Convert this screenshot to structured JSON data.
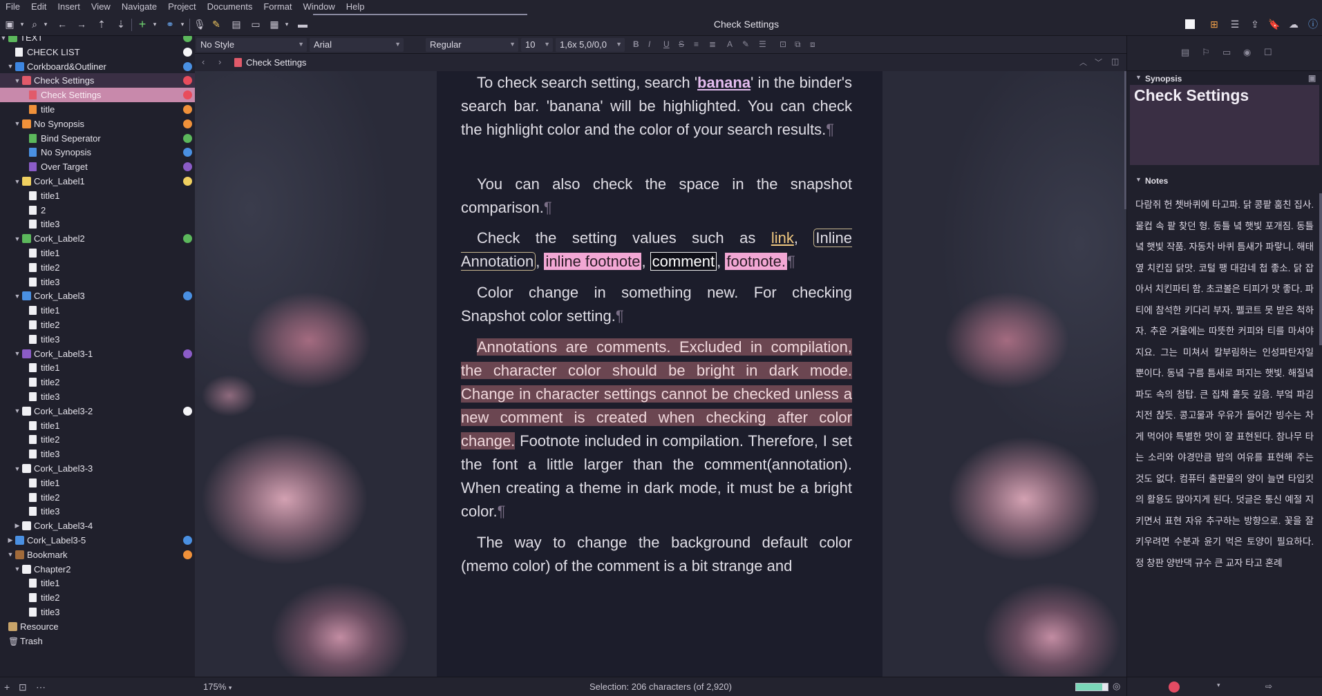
{
  "menubar": [
    "File",
    "Edit",
    "Insert",
    "View",
    "Navigate",
    "Project",
    "Documents",
    "Format",
    "Window",
    "Help"
  ],
  "window": {
    "title": "Check Settings"
  },
  "toolbar": {
    "icons": [
      "binder-toggle-icon",
      "search-icon",
      "back-icon",
      "forward-icon",
      "move-up-icon",
      "move-down-icon",
      "add-icon",
      "link-icon",
      "microphone-icon",
      "edit-icon",
      "editor-icon",
      "layout-icon",
      "composition-icon",
      "view-mode-icon",
      "corkboard-icon",
      "outliner-icon",
      "share-icon",
      "bookmark-icon",
      "cloud-icon",
      "info-icon"
    ]
  },
  "binder": {
    "items": [
      {
        "label": "TEXT",
        "level": 0,
        "arrow": "down",
        "icon": "folder",
        "color": "#5cb85c",
        "dot": "#5cb85c"
      },
      {
        "label": "CHECK LIST",
        "level": 1,
        "arrow": "",
        "icon": "doc",
        "color": "#f0f0f4",
        "dot": "#f5f5f8"
      },
      {
        "label": "Corkboard&Outliner",
        "level": 1,
        "arrow": "down",
        "icon": "folder",
        "color": "#3d86e0",
        "dot": "#4a90e2"
      },
      {
        "label": "Check Settings",
        "level": 2,
        "arrow": "down",
        "icon": "folder",
        "color": "#e15a6a",
        "dot": "#e84c5c",
        "state": "parent-selected"
      },
      {
        "label": "Check Settings",
        "level": 3,
        "arrow": "",
        "icon": "doc",
        "color": "#e15a6a",
        "dot": "#e84c5c",
        "state": "selected"
      },
      {
        "label": "title",
        "level": 3,
        "arrow": "",
        "icon": "doc",
        "color": "#f0913a",
        "dot": "#f0913a"
      },
      {
        "label": "No Synopsis",
        "level": 2,
        "arrow": "down",
        "icon": "folder",
        "color": "#f0913a",
        "dot": "#f0913a"
      },
      {
        "label": "Bind Seperator",
        "level": 3,
        "arrow": "",
        "icon": "doc",
        "color": "#5cb85c",
        "dot": "#5cb85c"
      },
      {
        "label": "No Synopsis",
        "level": 3,
        "arrow": "",
        "icon": "doc",
        "color": "#4a90e2",
        "dot": "#4a90e2"
      },
      {
        "label": "Over Target",
        "level": 3,
        "arrow": "",
        "icon": "doc",
        "color": "#8b5cc7",
        "dot": "#8b5cc7"
      },
      {
        "label": "Cork_Label1",
        "level": 2,
        "arrow": "down",
        "icon": "folder",
        "color": "#f0d060",
        "dot": "#f0d060"
      },
      {
        "label": "title1",
        "level": 3,
        "arrow": "",
        "icon": "doc",
        "color": "#f0f0f4",
        "dot": ""
      },
      {
        "label": "2",
        "level": 3,
        "arrow": "",
        "icon": "doc",
        "color": "#f0f0f4",
        "dot": ""
      },
      {
        "label": "title3",
        "level": 3,
        "arrow": "",
        "icon": "doc",
        "color": "#f0f0f4",
        "dot": ""
      },
      {
        "label": "Cork_Label2",
        "level": 2,
        "arrow": "down",
        "icon": "folder",
        "color": "#5cb85c",
        "dot": "#5cb85c"
      },
      {
        "label": "title1",
        "level": 3,
        "arrow": "",
        "icon": "doc",
        "color": "#f0f0f4",
        "dot": ""
      },
      {
        "label": "title2",
        "level": 3,
        "arrow": "",
        "icon": "doc",
        "color": "#f0f0f4",
        "dot": ""
      },
      {
        "label": "title3",
        "level": 3,
        "arrow": "",
        "icon": "doc",
        "color": "#f0f0f4",
        "dot": ""
      },
      {
        "label": "Cork_Label3",
        "level": 2,
        "arrow": "down",
        "icon": "folder",
        "color": "#4a90e2",
        "dot": "#4a90e2"
      },
      {
        "label": "title1",
        "level": 3,
        "arrow": "",
        "icon": "doc",
        "color": "#f0f0f4",
        "dot": ""
      },
      {
        "label": "title2",
        "level": 3,
        "arrow": "",
        "icon": "doc",
        "color": "#f0f0f4",
        "dot": ""
      },
      {
        "label": "title3",
        "level": 3,
        "arrow": "",
        "icon": "doc",
        "color": "#f0f0f4",
        "dot": ""
      },
      {
        "label": "Cork_Label3-1",
        "level": 2,
        "arrow": "down",
        "icon": "folder",
        "color": "#8b5cc7",
        "dot": "#8b5cc7"
      },
      {
        "label": "title1",
        "level": 3,
        "arrow": "",
        "icon": "doc",
        "color": "#f0f0f4",
        "dot": ""
      },
      {
        "label": "title2",
        "level": 3,
        "arrow": "",
        "icon": "doc",
        "color": "#f0f0f4",
        "dot": ""
      },
      {
        "label": "title3",
        "level": 3,
        "arrow": "",
        "icon": "doc",
        "color": "#f0f0f4",
        "dot": ""
      },
      {
        "label": "Cork_Label3-2",
        "level": 2,
        "arrow": "down",
        "icon": "folder",
        "color": "#f0f0f4",
        "dot": "#f5f5f8"
      },
      {
        "label": "title1",
        "level": 3,
        "arrow": "",
        "icon": "doc",
        "color": "#f0f0f4",
        "dot": ""
      },
      {
        "label": "title2",
        "level": 3,
        "arrow": "",
        "icon": "doc",
        "color": "#f0f0f4",
        "dot": ""
      },
      {
        "label": "title3",
        "level": 3,
        "arrow": "",
        "icon": "doc",
        "color": "#f0f0f4",
        "dot": ""
      },
      {
        "label": "Cork_Label3-3",
        "level": 2,
        "arrow": "down",
        "icon": "folder",
        "color": "#f0f0f4",
        "dot": ""
      },
      {
        "label": "title1",
        "level": 3,
        "arrow": "",
        "icon": "doc",
        "color": "#f0f0f4",
        "dot": ""
      },
      {
        "label": "title2",
        "level": 3,
        "arrow": "",
        "icon": "doc",
        "color": "#f0f0f4",
        "dot": ""
      },
      {
        "label": "title3",
        "level": 3,
        "arrow": "",
        "icon": "doc",
        "color": "#f0f0f4",
        "dot": ""
      },
      {
        "label": "Cork_Label3-4",
        "level": 2,
        "arrow": "right",
        "icon": "folder",
        "color": "#f0f0f4",
        "dot": ""
      },
      {
        "label": "Cork_Label3-5",
        "level": 1,
        "arrow": "right",
        "icon": "folder",
        "color": "#4a90e2",
        "dot": "#4a90e2"
      },
      {
        "label": "Bookmark",
        "level": 1,
        "arrow": "down",
        "icon": "folder",
        "color": "#a06a3a",
        "dot": "#f0913a"
      },
      {
        "label": "Chapter2",
        "level": 2,
        "arrow": "down",
        "icon": "folder",
        "color": "#f0f0f4",
        "dot": ""
      },
      {
        "label": "title1",
        "level": 3,
        "arrow": "",
        "icon": "doc",
        "color": "#f0f0f4",
        "dot": ""
      },
      {
        "label": "title2",
        "level": 3,
        "arrow": "",
        "icon": "doc",
        "color": "#f0f0f4",
        "dot": ""
      },
      {
        "label": "title3",
        "level": 3,
        "arrow": "",
        "icon": "doc",
        "color": "#f0f0f4",
        "dot": ""
      },
      {
        "label": "Resource",
        "level": 0,
        "arrow": "",
        "icon": "folder",
        "color": "#c8a46a",
        "dot": ""
      },
      {
        "label": "Trash",
        "level": 0,
        "arrow": "",
        "icon": "trash",
        "color": "#c9c6d2",
        "dot": ""
      }
    ]
  },
  "formatbar": {
    "style": "No Style",
    "font": "Arial",
    "weight": "Regular",
    "size": "10",
    "spacing": "1,6x 5,0/0,0",
    "buttons": [
      "B",
      "I",
      "U",
      "S",
      "≡",
      "≣",
      "A",
      "✎",
      "☰",
      "⊡",
      "⧉",
      "⧈"
    ]
  },
  "editor_header": {
    "doc_title": "Check Settings"
  },
  "editor": {
    "p1": {
      "before": "To check search setting, search '",
      "search_term": "banana",
      "after": "' in the binder's search bar. 'banana' will be highlighted. You can check the highlight color and the color of your search results."
    },
    "p2": "You can also check the space in the snapshot comparison.",
    "p3": {
      "before": "Check the setting values such as ",
      "link": "link",
      "comma1": ", ",
      "annotation": "Inline Annotation",
      "comma2": ", ",
      "inline_footnote": "inline footnote",
      "comma3": ", ",
      "comment": "comment",
      "comma4": ", ",
      "footnote": "footnote."
    },
    "p4": "Color change in something new. For checking Snapshot color setting.",
    "p5": {
      "annotated": "Annotations are comments. Excluded in compilation, the character color should be bright in dark mode. Change in character settings cannot be checked unless a new comment is created when checking after color change.",
      "rest": " Footnote included in compilation. Therefore, I set the font a little larger than the comment(annotation). When creating a theme in dark mode, it must be a bright color."
    },
    "p6": "The way to change the background default color (memo color) of the comment is a bit strange and",
    "pilcrow": "¶"
  },
  "status": {
    "zoom": "175%",
    "selection": "Selection: 206 characters (of 2,920)",
    "progress_fraction": 0.82,
    "progress_color": "#7ad6b8"
  },
  "inspector": {
    "synopsis_label": "Synopsis",
    "synopsis_title": "Check Settings",
    "notes_label": "Notes",
    "notes_text": "다람쥐 헌 쳇바퀴에 타고파. 닭 콩팥 훔친 집사. 물컵 속 팥 찾던 형. 동틀 녘 햇빛 포개짐. 동틀 녘 햇빛 작품. 자동차 바퀴 틈새가 파랗니. 해태 옆 치킨집 닭맛. 코털 팽 대감네 첩 좋소. 닭 잡아서 치킨파티 함. 초코볼은 티피가 맛 좋다. 파티에 참석한 키다리 부자. 펠코트 못 받은 척하자. 추운 겨울에는 따뜻한 커피와 티를 마셔야지요. 그는 미쳐서 칼부림하는 인성파탄자일 뿐이다. 동녘 구름 틈새로 퍼지는 햇빛. 해질녘 파도 속의 첨탑. 큰 집채 흩듯 깊음. 부엌 파김치전 찮듯. 콩고물과 우유가 들어간 빙수는 차게 먹어야 특별한 맛이 잘 표현된다. 참나무 타는 소리와 야경만큼 밤의 여유를 표현해 주는 것도 없다. 컴퓨터 출판물의 양이 늘면 타입킷의 활용도 많아지게 된다. 덧글은 통신 예절 지키면서 표현 자유 추구하는 방향으로. 꽃을 잘 키우려면 수분과 윤기 먹은 토양이 필요하다. 정 창판 양반댁 규수 큰 교자 타고 혼례"
  }
}
